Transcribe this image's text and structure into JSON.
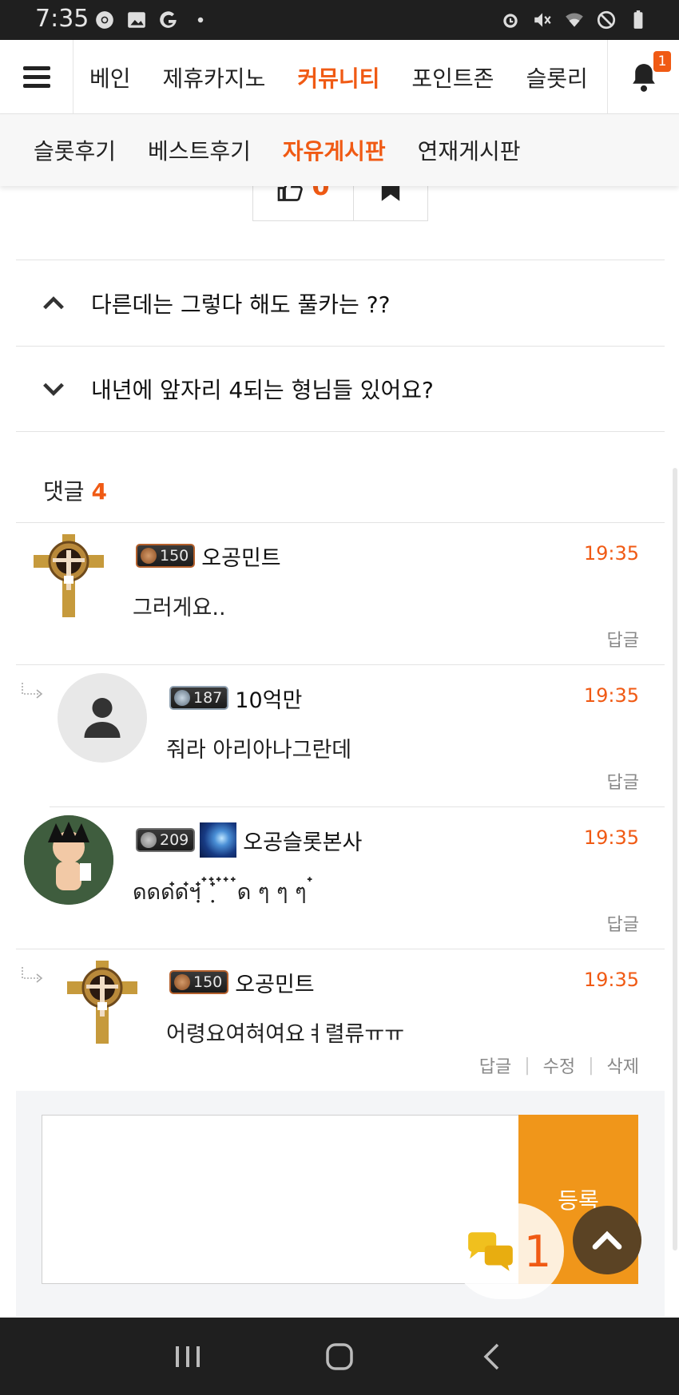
{
  "status_bar": {
    "time": "7:35",
    "left_icons": [
      "chrome-icon",
      "image-icon",
      "google-icon",
      "dot-icon"
    ],
    "right_icons": [
      "alarm-icon",
      "mute-icon",
      "wifi-icon",
      "no-sign-icon",
      "battery-icon"
    ]
  },
  "top_nav": {
    "items": [
      "베인",
      "제휴카지노",
      "커뮤니티",
      "포인트존",
      "슬롯리"
    ],
    "active_index": 2,
    "notification_count": "1"
  },
  "sub_nav": {
    "items": [
      "슬롯후기",
      "베스트후기",
      "자유게시판",
      "연재게시판"
    ],
    "active_index": 2
  },
  "vote": {
    "like_count": "0"
  },
  "post_nav": {
    "prev_title": "다른데는 그렇다 해도 풀카는 ??",
    "next_title": "내년에 앞자리 4되는 형님들 있어요?"
  },
  "comments_header": {
    "label": "댓글",
    "count": "4"
  },
  "comments": [
    {
      "level": "150",
      "nick": "오공민트",
      "time": "19:35",
      "body": "그러게요..",
      "actions": [
        "답글"
      ],
      "reply": false
    },
    {
      "level": "187",
      "nick": "10억만",
      "time": "19:35",
      "body": "줘라 아리아나그란데",
      "actions": [
        "답글"
      ],
      "reply": true
    },
    {
      "level": "209",
      "nick": "오공슬롯본사",
      "time": "19:35",
      "body": "ดดด๋ด๋ฯฺ๋ ๋ ฺ๋๋ ๋ ๋ ๋ด ๆ ๆ ๆ ๋",
      "actions": [
        "답글"
      ],
      "reply": false
    },
    {
      "level": "150",
      "nick": "오공민트",
      "time": "19:35",
      "body": "어령요여혀여요ㅕ렬류ㅠㅠ",
      "actions": [
        "답글",
        "수정",
        "삭제"
      ],
      "reply": true
    }
  ],
  "composer": {
    "submit_label": "등록"
  },
  "chat_fab": {
    "count": "1"
  },
  "colors": {
    "accent": "#f05a14",
    "submit": "#f0961a",
    "top_button": "#5b4324"
  }
}
